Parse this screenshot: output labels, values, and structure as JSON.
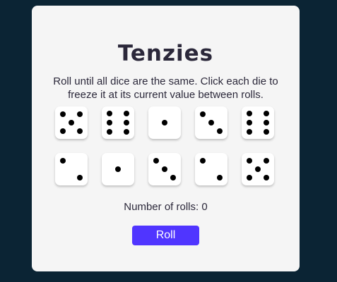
{
  "game": {
    "title": "Tenzies",
    "instructions": "Roll until all dice are the same. Click each die to freeze it at its current value between rolls.",
    "rolls_label": "Number of rolls:",
    "rolls_count": "0",
    "roll_button": "Roll"
  },
  "dice": [
    {
      "value": 5,
      "held": false
    },
    {
      "value": 6,
      "held": false
    },
    {
      "value": 1,
      "held": false
    },
    {
      "value": 3,
      "held": false
    },
    {
      "value": 6,
      "held": false
    },
    {
      "value": 2,
      "held": false
    },
    {
      "value": 1,
      "held": false
    },
    {
      "value": 3,
      "held": false
    },
    {
      "value": 2,
      "held": false
    },
    {
      "value": 5,
      "held": false
    }
  ],
  "colors": {
    "background": "#0b2434",
    "card": "#f5f5f5",
    "die_face": "#ffffff",
    "pip": "#000000",
    "accent": "#5035ff",
    "text": "#2b283a"
  }
}
